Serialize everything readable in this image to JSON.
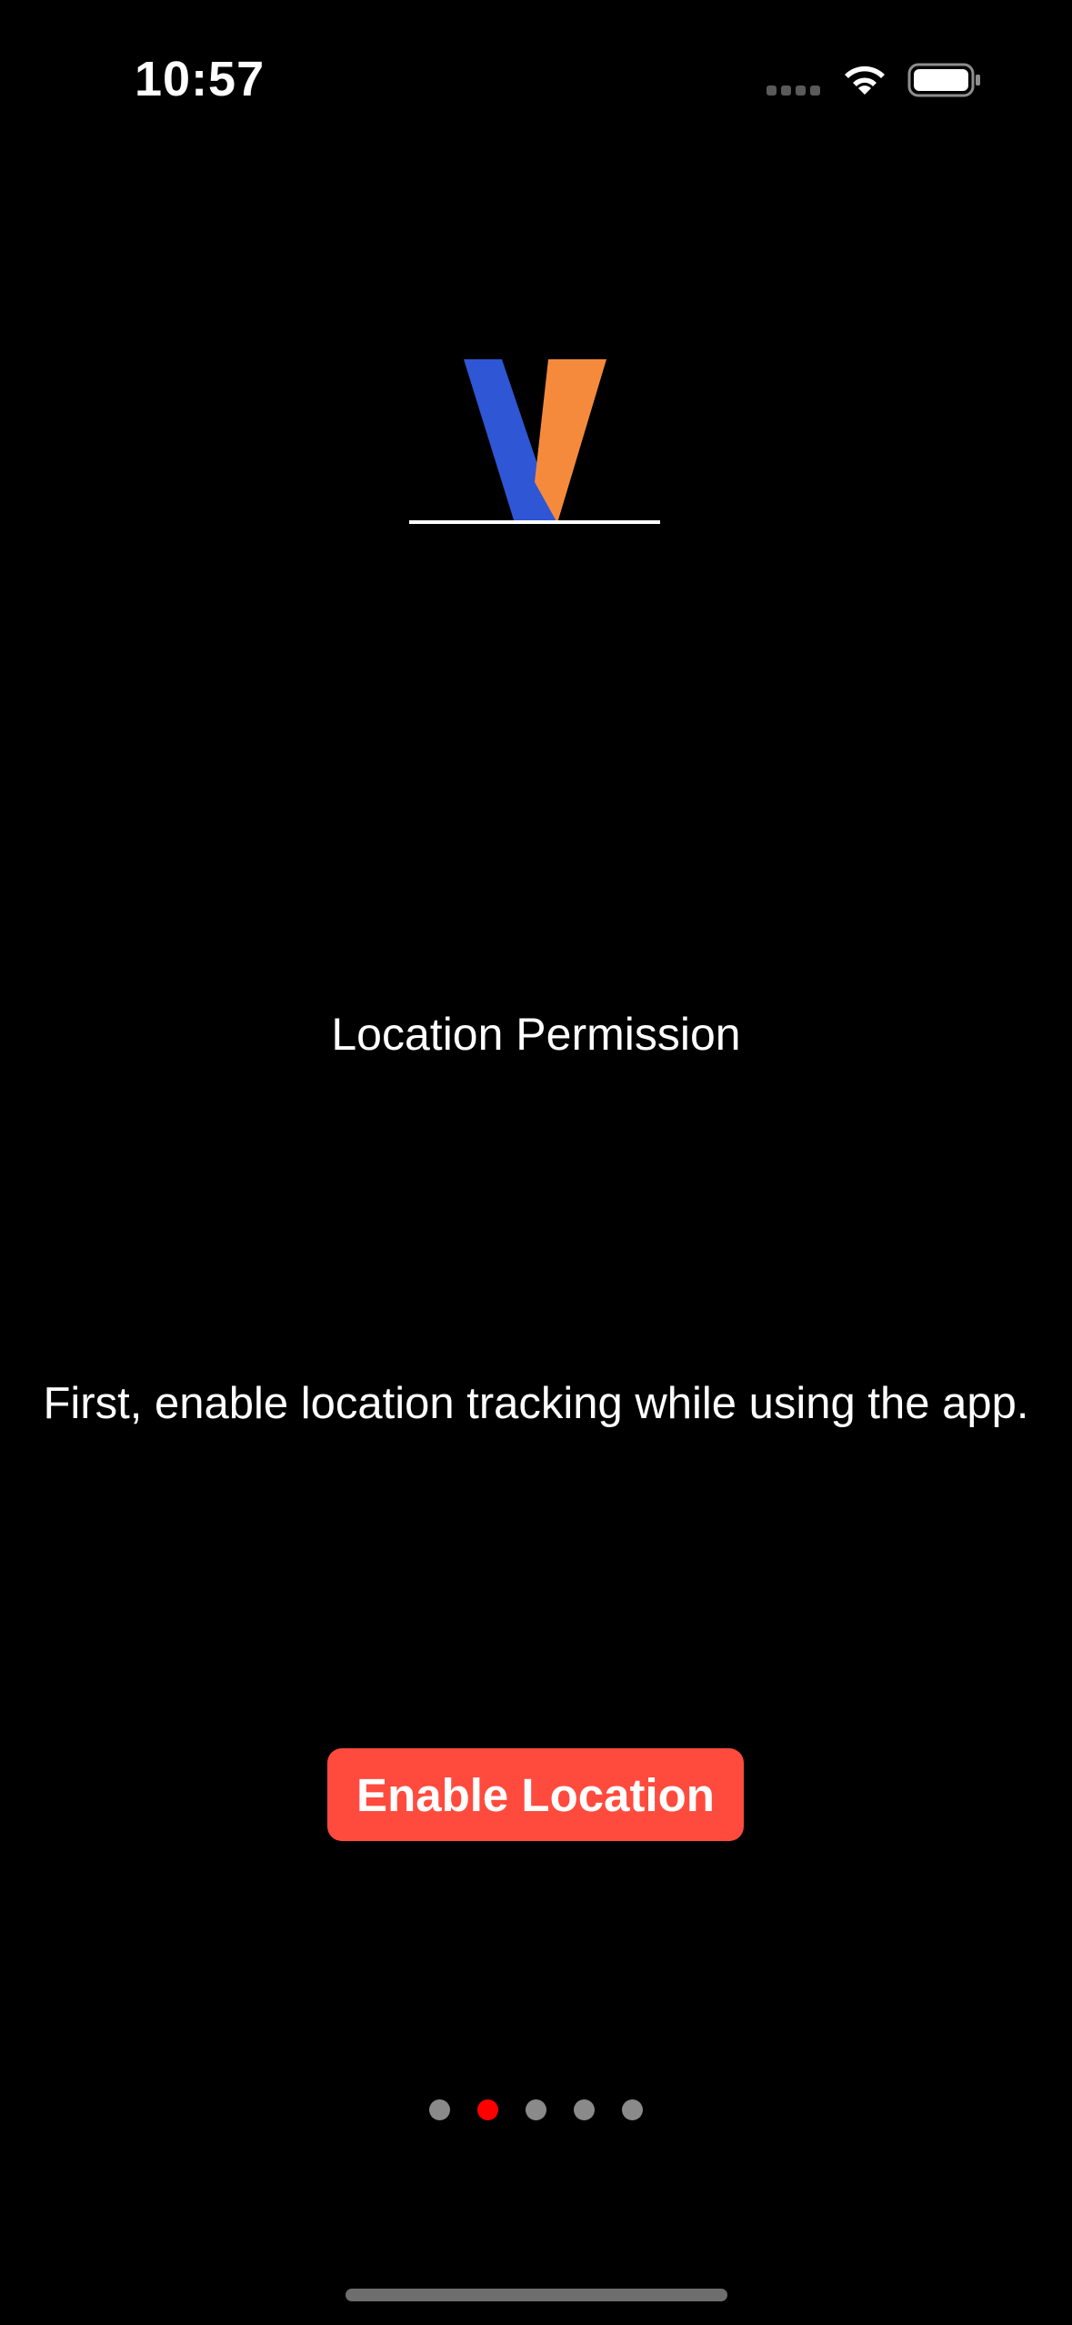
{
  "status_bar": {
    "time": "10:57"
  },
  "onboarding": {
    "title": "Location Permission",
    "description": "First, enable location tracking while using the app.",
    "enable_button_label": "Enable Location"
  },
  "pager": {
    "total_pages": 5,
    "current_page": 2
  },
  "colors": {
    "background": "#000000",
    "accent_button": "#ff4b3e",
    "active_dot": "#ff0000",
    "inactive_dot": "#8a8a8a",
    "logo_blue": "#2f56d4",
    "logo_orange": "#f58a3c"
  },
  "icons": {
    "signal": "cellular-signal-icon",
    "wifi": "wifi-icon",
    "battery": "battery-icon",
    "logo": "v-logo"
  }
}
